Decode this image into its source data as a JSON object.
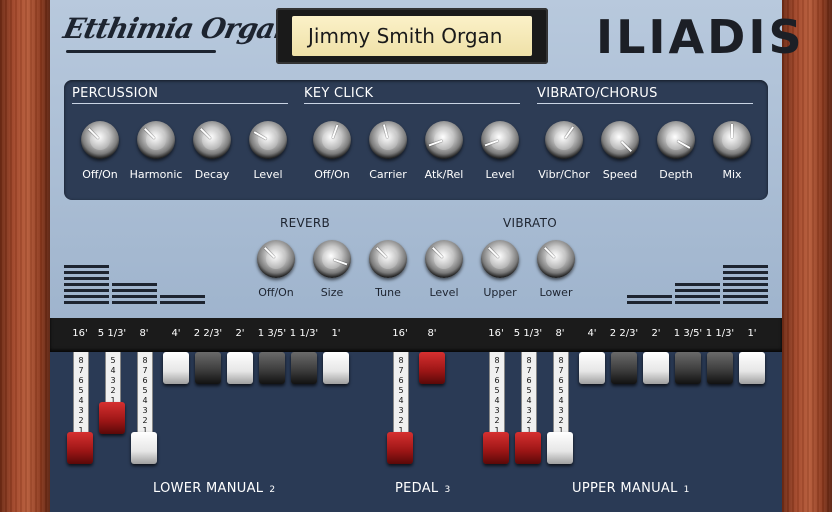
{
  "header": {
    "brand": "Etthimia Organ",
    "preset_display": "Jimmy Smith Organ",
    "logo": "ILIADIS"
  },
  "fx": {
    "sections": [
      {
        "title": "PERCUSSION",
        "knobs": [
          "Off/On",
          "Harmonic",
          "Decay",
          "Level"
        ]
      },
      {
        "title": "KEY CLICK",
        "knobs": [
          "Off/On",
          "Carrier",
          "Atk/Rel",
          "Level"
        ]
      },
      {
        "title": "VIBRATO/CHORUS",
        "knobs": [
          "Vibr/Chor",
          "Speed",
          "Depth",
          "Mix"
        ]
      }
    ]
  },
  "reverb": {
    "title": "REVERB",
    "knobs": [
      "Off/On",
      "Size",
      "Tune",
      "Level"
    ]
  },
  "vibrato": {
    "title": "VIBRATO",
    "knobs": [
      "Upper",
      "Lower"
    ]
  },
  "manuals": {
    "lower": {
      "label": "LOWER MANUAL",
      "number": "2",
      "footages": [
        "16'",
        "5 1/3'",
        "8'",
        "4'",
        "2 2/3'",
        "2'",
        "1 3/5'",
        "1 1/3'",
        "1'"
      ],
      "levels": [
        8,
        5,
        8,
        0,
        0,
        0,
        0,
        0,
        0
      ]
    },
    "pedal": {
      "label": "PEDAL",
      "number": "3",
      "footages": [
        "16'",
        "8'"
      ],
      "levels": [
        8,
        0
      ]
    },
    "upper": {
      "label": "UPPER MANUAL",
      "number": "1",
      "footages": [
        "16'",
        "5 1/3'",
        "8'",
        "4'",
        "2 2/3'",
        "2'",
        "1 3/5'",
        "1 1/3'",
        "1'"
      ],
      "levels": [
        8,
        8,
        8,
        0,
        0,
        0,
        0,
        0,
        0
      ]
    }
  },
  "colors": {
    "panel": "#a9bdd4",
    "fx_box": "#2d3c55",
    "drawbar_bg": "#2a3a55",
    "wood": "#a5482a",
    "display": "#f5e9b8",
    "drawbar_red": "#9b1515"
  },
  "icons": [
    "knob-icon",
    "drawbar-tab-icon",
    "level-meter-icon"
  ]
}
